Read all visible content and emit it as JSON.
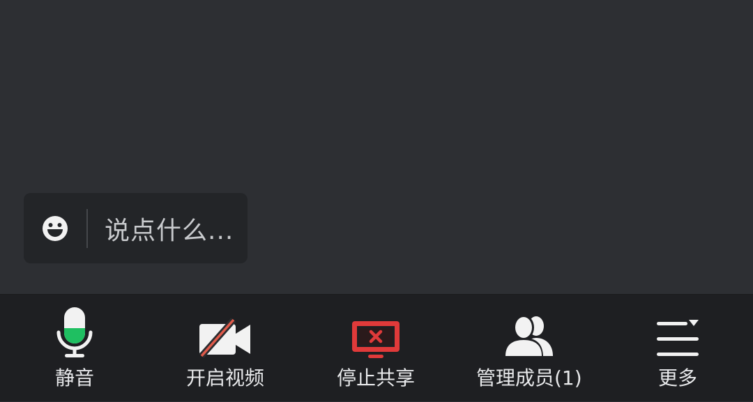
{
  "chat": {
    "placeholder": "说点什么...",
    "emoji_icon": "smiley-icon"
  },
  "toolbar": {
    "items": [
      {
        "label": "静音",
        "icon": "microphone-icon"
      },
      {
        "label": "开启视频",
        "icon": "video-camera-off-icon"
      },
      {
        "label": "停止共享",
        "icon": "stop-screen-share-icon"
      },
      {
        "label": "管理成员(1)",
        "icon": "members-icon"
      },
      {
        "label": "更多",
        "icon": "more-menu-icon"
      }
    ]
  },
  "colors": {
    "stage_bg": "#2d2f33",
    "toolbar_bg": "#1e1f22",
    "mic_level": "#1fbf61",
    "share_red": "#e03a3a",
    "video_off_red": "#e05a4a",
    "icon_white": "#f2f2f2"
  }
}
